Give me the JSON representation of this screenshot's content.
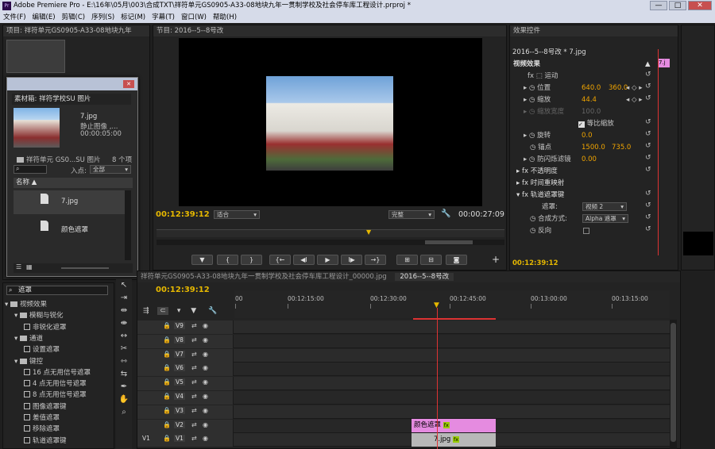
{
  "window": {
    "title": "Adobe Premiere Pro - E:\\16年\\05月\\003\\合成TXT\\祥符单元GS0905-A33-08地块九年一贯制学校及社会停车库工程设计.prproj *",
    "app_icon": "Pr",
    "min": "—",
    "max": "□",
    "close": "✕"
  },
  "menu": [
    "文件(F)",
    "编辑(E)",
    "剪辑(C)",
    "序列(S)",
    "标记(M)",
    "字幕(T)",
    "窗口(W)",
    "帮助(H)"
  ],
  "project": {
    "tab": "项目: 祥符单元GS0905-A33-08地块九年"
  },
  "bin": {
    "tab": "素材箱: 祥符学校SU 图片",
    "file_name": "7.jpg",
    "file_type": "静止图像 ,...",
    "file_duration": "00:00:05:00",
    "folder": "祥符单元 GS0...SU 图片",
    "count": "8 个项",
    "inpoint_label": "入点:",
    "inpoint_value": "全部",
    "col_name": "名称",
    "items": [
      "7.jpg",
      "颜色遮罩"
    ]
  },
  "program": {
    "tab": "节目: 2016--5--8号改",
    "timecode": "00:12:39:12",
    "fit": "适合",
    "quality": "完整",
    "duration": "00:00:27:09"
  },
  "transport": {
    "marker": "▼",
    "in": "{",
    "out": "}",
    "go_in": "{←",
    "step_back": "◀I",
    "play": "▶",
    "step_fwd": "I▶",
    "go_out": "→}",
    "lift": "⊞",
    "extract": "⊟",
    "export": "◙",
    "add": "+"
  },
  "effect_controls": {
    "tab": "效果控件",
    "clip": "2016--5--8号改 * 7.jpg",
    "mini_clip": "7.j",
    "section": "视频效果",
    "motion": "运动",
    "position_label": "位置",
    "position_x": "640.0",
    "position_y": "360.0",
    "scale_label": "缩放",
    "scale_value": "44.4",
    "scale_width_label": "缩放宽度",
    "scale_width_value": "100.0",
    "uniform_label": "等比缩放",
    "rotation_label": "旋转",
    "rotation_value": "0.0",
    "anchor_label": "锚点",
    "anchor_x": "1500.0",
    "anchor_y": "735.0",
    "antiflicker_label": "防闪烁滤镜",
    "antiflicker_value": "0.00",
    "opacity": "不透明度",
    "time_remap": "时间重映射",
    "track_matte": "轨道遮罩键",
    "matte_label": "遮罩:",
    "matte_value": "视频 2",
    "composite_label": "合成方式:",
    "composite_value": "Alpha 遮罩",
    "reverse_label": "反向",
    "footer_tc": "00:12:39:12"
  },
  "effects": {
    "search": "遮罩",
    "tree": [
      {
        "label": "视频效果",
        "level": 0,
        "type": "folder"
      },
      {
        "label": "模糊与锐化",
        "level": 1,
        "type": "folder"
      },
      {
        "label": "非锐化遮罩",
        "level": 2,
        "type": "fx"
      },
      {
        "label": "通道",
        "level": 1,
        "type": "folder"
      },
      {
        "label": "设置遮罩",
        "level": 2,
        "type": "fx"
      },
      {
        "label": "键控",
        "level": 1,
        "type": "folder"
      },
      {
        "label": "16 点无用信号遮罩",
        "level": 2,
        "type": "fx"
      },
      {
        "label": "4 点无用信号遮罩",
        "level": 2,
        "type": "fx"
      },
      {
        "label": "8 点无用信号遮罩",
        "level": 2,
        "type": "fx"
      },
      {
        "label": "图像遮罩键",
        "level": 2,
        "type": "fx"
      },
      {
        "label": "差值遮罩",
        "level": 2,
        "type": "fx"
      },
      {
        "label": "移除遮罩",
        "level": 2,
        "type": "fx"
      },
      {
        "label": "轨道遮罩键",
        "level": 2,
        "type": "fx"
      }
    ]
  },
  "timeline": {
    "tab1": "祥符单元GS0905-A33-08地块九年一贯制学校及社会停车库工程设计_00000.jpg",
    "tab2": "2016--5--8号改",
    "timecode": "00:12:39:12",
    "ruler": [
      "00",
      "00:12:15:00",
      "00:12:30:00",
      "00:12:45:00",
      "00:13:00:00",
      "00:13:15:00"
    ],
    "tracks": [
      "V9",
      "V8",
      "V7",
      "V6",
      "V5",
      "V4",
      "V3",
      "V2",
      "V1"
    ],
    "source_v1": "V1",
    "clip_v2": "颜色遮罩",
    "clip_v1": "7.jpg",
    "fx_badge": "fx"
  }
}
